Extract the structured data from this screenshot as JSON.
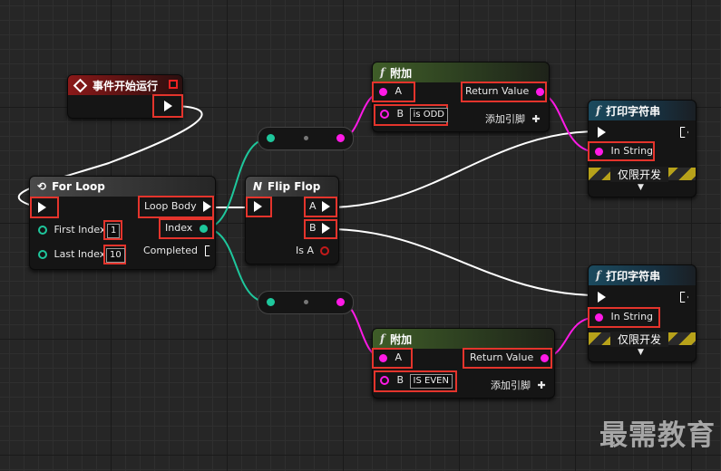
{
  "event_node": {
    "title": "事件开始运行"
  },
  "for_loop": {
    "title": "For Loop",
    "first_index_label": "First Index",
    "first_index_value": "1",
    "last_index_label": "Last Index",
    "last_index_value": "10",
    "loop_body_label": "Loop Body",
    "index_label": "Index",
    "completed_label": "Completed"
  },
  "flip_flop": {
    "title": "Flip Flop",
    "a_label": "A",
    "b_label": "B",
    "is_a_label": "Is A"
  },
  "append_top": {
    "title": "附加",
    "a_label": "A",
    "b_label": "B",
    "b_value": "is ODD",
    "return_label": "Return Value",
    "add_pin_label": "添加引脚"
  },
  "append_bottom": {
    "title": "附加",
    "a_label": "A",
    "b_label": "B",
    "b_value": "IS EVEN",
    "return_label": "Return Value",
    "add_pin_label": "添加引脚"
  },
  "print_top": {
    "title": "打印字符串",
    "in_string_label": "In String",
    "dev_only_label": "仅限开发"
  },
  "print_bottom": {
    "title": "打印字符串",
    "in_string_label": "In String",
    "dev_only_label": "仅限开发"
  },
  "watermark": "最需教育",
  "colors": {
    "exec_wire": "#ffffff",
    "int_wire": "#1ec79c",
    "string_wire": "#ff1ae6",
    "highlight": "#e4342c",
    "event_header": "#8a1919",
    "function_header": "#1b4a5e"
  }
}
